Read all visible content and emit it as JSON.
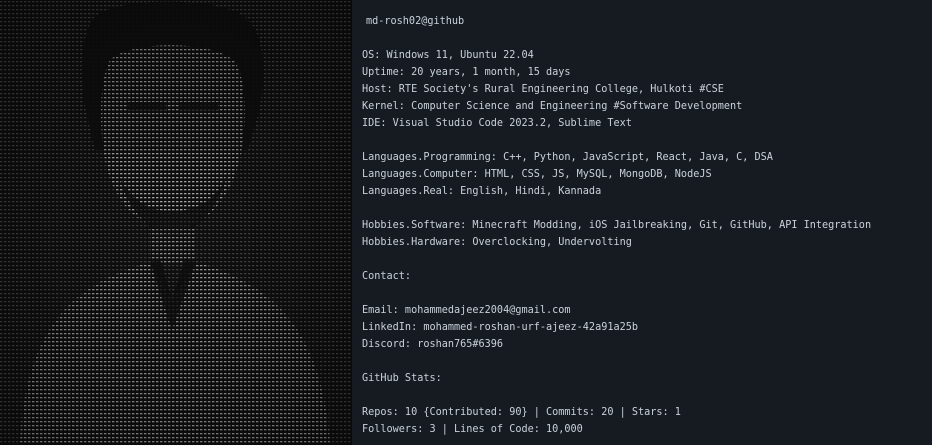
{
  "header": {
    "user_host": "md-rosh02@github"
  },
  "lines": [
    "OS: Windows 11, Ubuntu 22.04",
    "Uptime: 20 years, 1 month, 15 days",
    "Host: RTE Society's Rural Engineering College, Hulkoti #CSE",
    "Kernel: Computer Science and Engineering #Software Development",
    "IDE: Visual Studio Code 2023.2, Sublime Text",
    "Languages.Programming: C++, Python, JavaScript, React, Java, C, DSA",
    "Languages.Computer: HTML, CSS, JS, MySQL, MongoDB, NodeJS",
    "Languages.Real: English, Hindi, Kannada",
    "Hobbies.Software: Minecraft Modding, iOS Jailbreaking, Git, GitHub, API Integration",
    "Hobbies.Hardware: Overclocking, Undervolting",
    "Contact:",
    "Email: mohammedajeez2004@gmail.com",
    "LinkedIn: mohammed-roshan-urf-ajeez-42a91a25b",
    "Discord: roshan765#6396",
    "GitHub Stats:",
    "Repos: 10 {Contributed: 90} | Commits: 20 | Stars: 1",
    "Followers: 3 | Lines of Code: 10,000"
  ],
  "colors": {
    "panel_bg": "#161b22",
    "ascii_bg": "#0e0e0e",
    "text": "#c9d1d9"
  }
}
